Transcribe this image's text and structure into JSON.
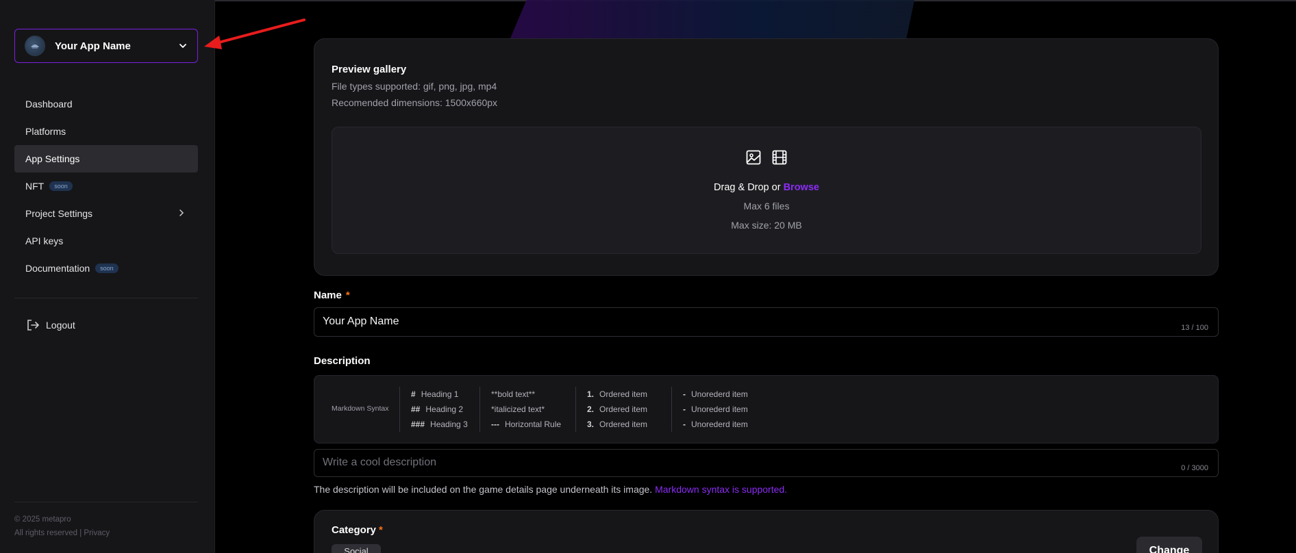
{
  "app_switcher": {
    "name": "Your App Name"
  },
  "nav": {
    "items": [
      {
        "label": "Dashboard"
      },
      {
        "label": "Platforms"
      },
      {
        "label": "App Settings"
      },
      {
        "label": "NFT",
        "badge": "soon"
      },
      {
        "label": "Project Settings"
      },
      {
        "label": "API keys"
      },
      {
        "label": "Documentation",
        "badge": "soon"
      }
    ],
    "logout": "Logout"
  },
  "footer": {
    "copyright": "© 2025 metapro",
    "links": "All rights reserved | Privacy"
  },
  "gallery": {
    "title": "Preview gallery",
    "file_types": "File types supported: gif, png, jpg, mp4",
    "dimensions": "Recomended dimensions: 1500x660px",
    "drop_text": "Drag & Drop or",
    "browse": "Browse",
    "max_files": "Max 6 files",
    "max_size": "Max size: 20 MB"
  },
  "name_field": {
    "label": "Name",
    "required": "*",
    "value": "Your App Name",
    "counter": "13 / 100"
  },
  "description": {
    "label": "Description",
    "markdown_label": "Markdown Syntax",
    "headings": [
      {
        "sym": "#",
        "text": "Heading 1"
      },
      {
        "sym": "##",
        "text": "Heading 2"
      },
      {
        "sym": "###",
        "text": "Heading 3"
      }
    ],
    "formatting": [
      "**bold text**",
      "*italicized text*"
    ],
    "hr": {
      "sym": "---",
      "text": "Horizontal Rule"
    },
    "ordered": [
      {
        "sym": "1.",
        "text": "Ordered item"
      },
      {
        "sym": "2.",
        "text": "Ordered item"
      },
      {
        "sym": "3.",
        "text": "Ordered item"
      }
    ],
    "unordered": [
      {
        "sym": "-",
        "text": "Unorederd item"
      },
      {
        "sym": "-",
        "text": "Unorederd item"
      },
      {
        "sym": "-",
        "text": "Unorederd item"
      }
    ],
    "placeholder": "Write a cool description",
    "counter": "0 / 3000",
    "help_text": "The description will be included on the game details page underneath its image.",
    "help_link": "Markdown syntax is supported."
  },
  "category": {
    "title": "Category",
    "required": "*",
    "chip": "Social",
    "change_button": "Change"
  },
  "colors": {
    "accent": "#8b2cf5",
    "required": "#f97316",
    "annotation_arrow": "#e81c1c"
  }
}
